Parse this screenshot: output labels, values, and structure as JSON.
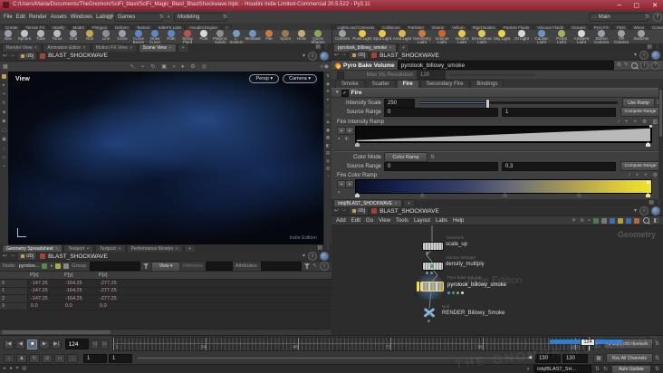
{
  "colors": {
    "titlebar": "#9c2f3c",
    "cache_bar": "#2e7fd2",
    "selection_glow": "#4a7ab0",
    "node_flag_yellow": "#ffd84a",
    "value_pink": "#c897ab"
  },
  "icons": {
    "chevron": "▾",
    "plus": "+",
    "close": "✕",
    "dots": "⋮",
    "layout": "▤",
    "stepper": "⇅",
    "back": "↩",
    "forward": "↪",
    "gear": "⚙",
    "pencil": "✎",
    "info": "i",
    "help": "?",
    "home": "⌂",
    "swap": "◑",
    "grid": "▦",
    "cursor": "↖",
    "rotate": "↻",
    "boxsel": "▣",
    "dot": "▪",
    "diamond": "♦",
    "target": "◎",
    "check": "✓",
    "slash": "∕",
    "swatch": "▥",
    "circle": "●",
    "play": "▶",
    "play_rev": "◀",
    "stop": "■",
    "to_start": "|◀",
    "to_end": "▶|",
    "step_b": "◁",
    "step_f": "▷",
    "note": "♪",
    "pose": "♟",
    "loop": "↻",
    "circle_dot": "⊙",
    "rect": "▭",
    "arrow_r": "→",
    "snap": "▦",
    "pin": "◉"
  },
  "window": {
    "title": "C:/Users/Maria/Documents/TheGnomon/SciFi_blast/SciFi_Magic_Blast_BlastShockwave.hipk: - Houdini Indie Limited-Commercial 20.5.522 - Py3.11",
    "minimize": "–",
    "maximize": "▢",
    "close": "✕"
  },
  "menubar": {
    "items": [
      "File",
      "Edit",
      "Render",
      "Assets",
      "Windows",
      "Labs",
      "Help"
    ],
    "games": "Games",
    "modeling": "Modeling",
    "main": "Main",
    "help_glyph": "?"
  },
  "shelf_left": {
    "tabs": [
      "Create",
      "Terrain FX",
      "Modify",
      "Model",
      "Polygon",
      "Deform",
      "Texture",
      "SideFX Labs",
      "Houdini Engine",
      "+"
    ],
    "active_tab": "Create",
    "tools": [
      {
        "label": "Box",
        "c": "#9aa0a8"
      },
      {
        "label": "Sphere",
        "c": "#c0c5cb"
      },
      {
        "label": "Tube",
        "c": "#b0b5bb"
      },
      {
        "label": "Torus",
        "c": "#b8bdc4"
      },
      {
        "label": "Grid",
        "c": "#9aa0a8"
      },
      {
        "label": "Null",
        "c": "#c8a84a"
      },
      {
        "label": "Line",
        "c": "#8a9098"
      },
      {
        "label": "Circle",
        "c": "#9aa0a8"
      },
      {
        "label": "Curve Bezier",
        "c": "#5b87c7"
      },
      {
        "label": "Draw Curve",
        "c": "#5b87c7"
      },
      {
        "label": "Path",
        "c": "#5b87c7"
      },
      {
        "label": "Spray Paint",
        "c": "#c05050"
      },
      {
        "label": "Font",
        "c": "#d8d8d8"
      },
      {
        "label": "Platonic Solids",
        "c": "#8a8f96"
      },
      {
        "label": "L-System",
        "c": "#7a9ac0"
      },
      {
        "label": "Metaball",
        "c": "#6f94c4"
      },
      {
        "label": "File",
        "c": "#c87840"
      },
      {
        "label": "Spiral",
        "c": "#9a7a50"
      },
      {
        "label": "Helix",
        "c": "#c8a878"
      },
      {
        "label": "Quick Shapes",
        "c": "#88a858"
      }
    ]
  },
  "shelf_right": {
    "tabs": [
      "Lights and Cameras",
      "Collisions",
      "Particles",
      "Grains",
      "Vellum",
      "Rigid Bodies",
      "Particle Fluids",
      "Viscous Fluids",
      "Oceans",
      "Pyro FX",
      "PDG",
      "Wires",
      "Crowds",
      "Drive Simulation",
      "+"
    ],
    "active_tab": "Lights and Cameras",
    "tools": [
      {
        "label": "Camera",
        "c": "#9aa0a8"
      },
      {
        "label": "Point Light",
        "c": "#e8c84a"
      },
      {
        "label": "Spot Light",
        "c": "#e8c84a"
      },
      {
        "label": "Area Light",
        "c": "#d4b84a"
      },
      {
        "label": "Geometry Light",
        "c": "#c87840"
      },
      {
        "label": "Volume Light",
        "c": "#c86830"
      },
      {
        "label": "Distant Light",
        "c": "#e8c84a"
      },
      {
        "label": "Environment Light",
        "c": "#d8cc50"
      },
      {
        "label": "Sky Light",
        "c": "#e8d44a"
      },
      {
        "label": "GI Light",
        "c": "#d8d8d0"
      },
      {
        "label": "Caustic Light",
        "c": "#6f94c4"
      },
      {
        "label": "Portal Light",
        "c": "#98b858"
      },
      {
        "label": "Ambient Light",
        "c": "#d8d8d8"
      },
      {
        "label": "Stereo Camera",
        "c": "#9aa0a8"
      },
      {
        "label": "VR Camera",
        "c": "#9aa0a8"
      },
      {
        "label": "Switcher",
        "c": "#9aa0a8"
      }
    ]
  },
  "scene": {
    "tabs": [
      "Render View",
      "Animation Editor",
      "Motion FX View",
      "Scene View"
    ],
    "plus": "+",
    "path_root": "obj",
    "path_node": "BLAST_SHOCKWAVE",
    "toolbar_glyphs": [
      "↖",
      "⌁",
      "↻",
      "▣",
      "▪",
      "♦",
      "⚙",
      "◎"
    ],
    "left_strip_glyphs": [
      "▸",
      "+",
      "↻",
      "◈",
      "◉",
      "▢",
      "▣",
      "⌂",
      "◇",
      "▪"
    ],
    "right_strip_glyphs": [
      "⇅",
      "◉",
      "✜",
      "▸",
      "∕",
      "◇",
      "◈",
      "▣",
      "▦",
      "◧",
      "▤",
      "◍",
      "▥",
      "◔"
    ],
    "view_label": "View",
    "persp_button": "Persp",
    "camera_button": "Camera",
    "watermark": "Indie Edition"
  },
  "spreadsheet": {
    "tabs": [
      "Geometry Spreadsheet",
      "Textport",
      "Textport",
      "Performance Monitor"
    ],
    "plus": "+",
    "path_root": "obj",
    "path_node": "BLAST_SHOCKWAVE",
    "node_label": "Node:",
    "node_value": "pyroloo...",
    "group_label": "Group:",
    "view_button": "View",
    "intrinsics_label": "Intrinsics",
    "attributes_label": "Attributes:",
    "columns": [
      "P[x]",
      "P[y]",
      "P[z]"
    ],
    "rows": [
      {
        "id": "0",
        "v0": "-147.25",
        "v1": "-164.25",
        "v2": "-277.25"
      },
      {
        "id": "1",
        "v0": "-147.25",
        "v1": "-164.25",
        "v2": "-277.25"
      },
      {
        "id": "2",
        "v0": "-147.25",
        "v1": "-164.25",
        "v2": "-277.25"
      },
      {
        "id": "3",
        "v0": "0.0",
        "v1": "0.0",
        "v2": "0.0"
      }
    ]
  },
  "params": {
    "tab": "pyrolook_billowy_smoke",
    "plus": "+",
    "path_root": "obj",
    "path_node": "BLAST_SHOCKWAVE",
    "node_type": "Pyro Bake Volume",
    "node_name": "pyrolook_billowy_smoke",
    "maxvis_label": "Max Vis Resolution",
    "maxvis_value": "128",
    "tabs": [
      "Smoke",
      "Scatter",
      "Fire",
      "Secondary Fire",
      "Bindings"
    ],
    "active_tab": "Fire",
    "section_label": "Fire",
    "intensity_label": "Intensity Scale",
    "intensity_value": "250",
    "use_ramp_button": "Use Ramp",
    "source_range_label": "Source Range",
    "source_range1_min": "0",
    "source_range1_max": "1",
    "compute_range_button": "Compute Range",
    "fire_intensity_ramp_label": "Fire Intensity Ramp",
    "color_mode_label": "Color Mode",
    "color_mode_value": "Color Ramp",
    "source_range2_min": "0",
    "source_range2_max": "0.3",
    "fire_color_ramp_label": "Fire Color Ramp",
    "fire_color_ramp_stops": [
      "#0a0e24",
      "#16234e",
      "#3c456a",
      "#717176",
      "#a89a55",
      "#d9c83b",
      "#f0e32d"
    ],
    "fire_color_ramp_marker_positions": [
      0,
      0.22,
      0.5,
      0.75,
      1.0
    ]
  },
  "network": {
    "tab": "/obj/BLAST_SHOCKWAVE",
    "plus": "+",
    "path_root": "obj",
    "path_node": "BLAST_SHOCKWAVE",
    "menu": [
      "Add",
      "Edit",
      "Go",
      "View",
      "Tools",
      "Layout",
      "Labs",
      "Help"
    ],
    "toolbar_glyphs": [
      "✛",
      "≋",
      "▪"
    ],
    "toolbar_colors": [
      "#4a7d4a",
      "#787878",
      "#3d6fae",
      "#b0a33d",
      "#3d6fae",
      "#b06a3d"
    ],
    "context_label": "Geometry",
    "watermark": "Indie Edition",
    "nodes": {
      "transform": {
        "type": "Transform",
        "name": "scale_up"
      },
      "wrangle": {
        "type": "Volume Wrangle",
        "name": "density_multiply"
      },
      "pyro": {
        "type": "Pyro Bake Volume",
        "name": "pyrolook_billowy_smoke"
      },
      "nullnode": {
        "type": "Null",
        "name": "RENDER_Billowy_Smoke"
      }
    }
  },
  "timeline": {
    "frame_field": "124",
    "flag": "124",
    "ruler_labels": [
      "1",
      "24",
      "48",
      "72",
      "96",
      "120"
    ],
    "toggle_glyphs": [
      "♪",
      "♟",
      "↻",
      "⊙",
      "▭",
      "→"
    ],
    "start": "1",
    "playback_start": "1",
    "end": "130",
    "playback_end": "130",
    "keys_button": "0 keys, 0/0 channels",
    "key_all_button": "Key All Channels"
  },
  "statusbar": {
    "left_glyphs": [
      "▸",
      "●",
      "⌗",
      "▤"
    ],
    "path_field": "/obj/BLAST_SH...",
    "auto_update_button": "Auto Update"
  },
  "watermark_text": "THE GNOMON WORKSHOP"
}
